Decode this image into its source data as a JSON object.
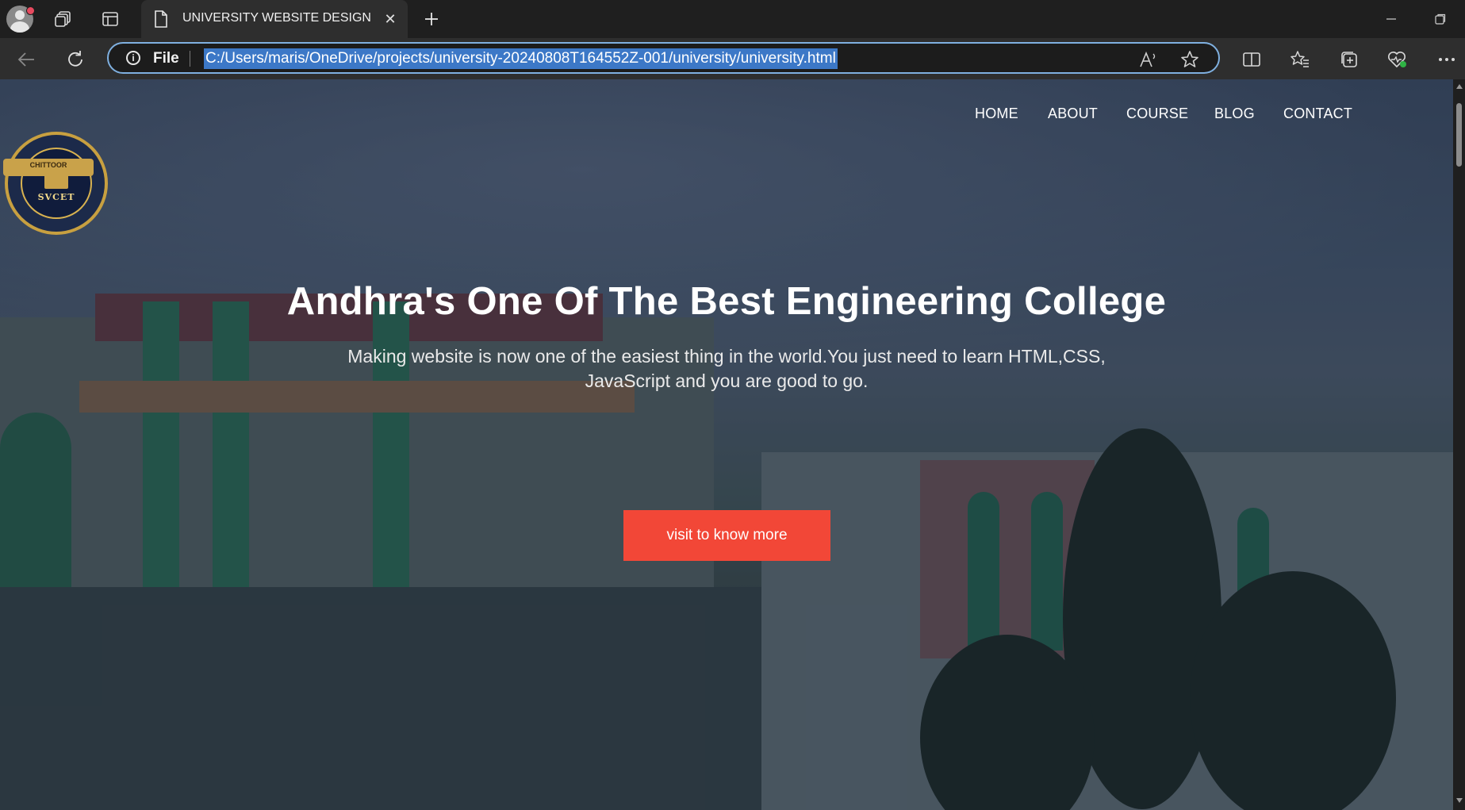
{
  "browser": {
    "tab": {
      "title": "UNIVERSITY WEBSITE DESIGN",
      "close_symbol": "✕"
    },
    "addressbar": {
      "scheme_label": "File",
      "url": "C:/Users/maris/OneDrive/projects/university-20240808T164552Z-001/university/university.html"
    }
  },
  "site": {
    "logo": {
      "text": "SVCET",
      "ribbon": "CHITTOOR"
    },
    "nav": {
      "items": [
        "HOME",
        "ABOUT",
        "COURSE",
        "BLOG",
        "CONTACT"
      ]
    },
    "hero": {
      "title": "Andhra's One Of The Best Engineering College",
      "subtitle_line1": "Making website is now one of the easiest thing in the world.You just need to learn HTML,CSS,",
      "subtitle_line2": "JavaScript and you are good to go.",
      "cta_label": "visit to know more"
    }
  },
  "colors": {
    "cta": "#f24737",
    "address_highlight": "#3c78c7",
    "address_border": "#7fb0e0"
  }
}
